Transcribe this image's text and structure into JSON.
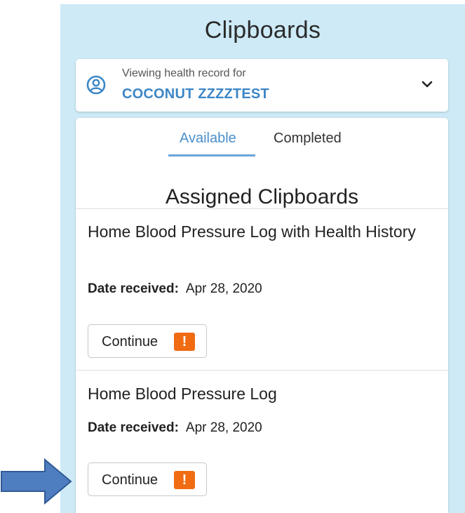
{
  "header": {
    "title": "Clipboards"
  },
  "patient": {
    "viewing_label": "Viewing health record for",
    "name": "COCONUT ZZZZTEST",
    "icon": "person-circle-icon",
    "expand_icon": "chevron-down-icon"
  },
  "tabs": [
    {
      "label": "Available",
      "active": true
    },
    {
      "label": "Completed",
      "active": false
    }
  ],
  "section_title": "Assigned Clipboards",
  "clipboards": [
    {
      "title": "Home Blood Pressure Log with Health History",
      "date_label": "Date received:",
      "date_value": "Apr 28, 2020",
      "button_label": "Continue",
      "alert_glyph": "!"
    },
    {
      "title": "Home Blood Pressure Log",
      "date_label": "Date received:",
      "date_value": "Apr 28, 2020",
      "button_label": "Continue",
      "alert_glyph": "!"
    }
  ],
  "colors": {
    "panel_bg": "#cdeaf6",
    "accent_blue": "#3c86c6",
    "alert_orange": "#f06b12",
    "arrow_blue": "#4f7ec0"
  }
}
